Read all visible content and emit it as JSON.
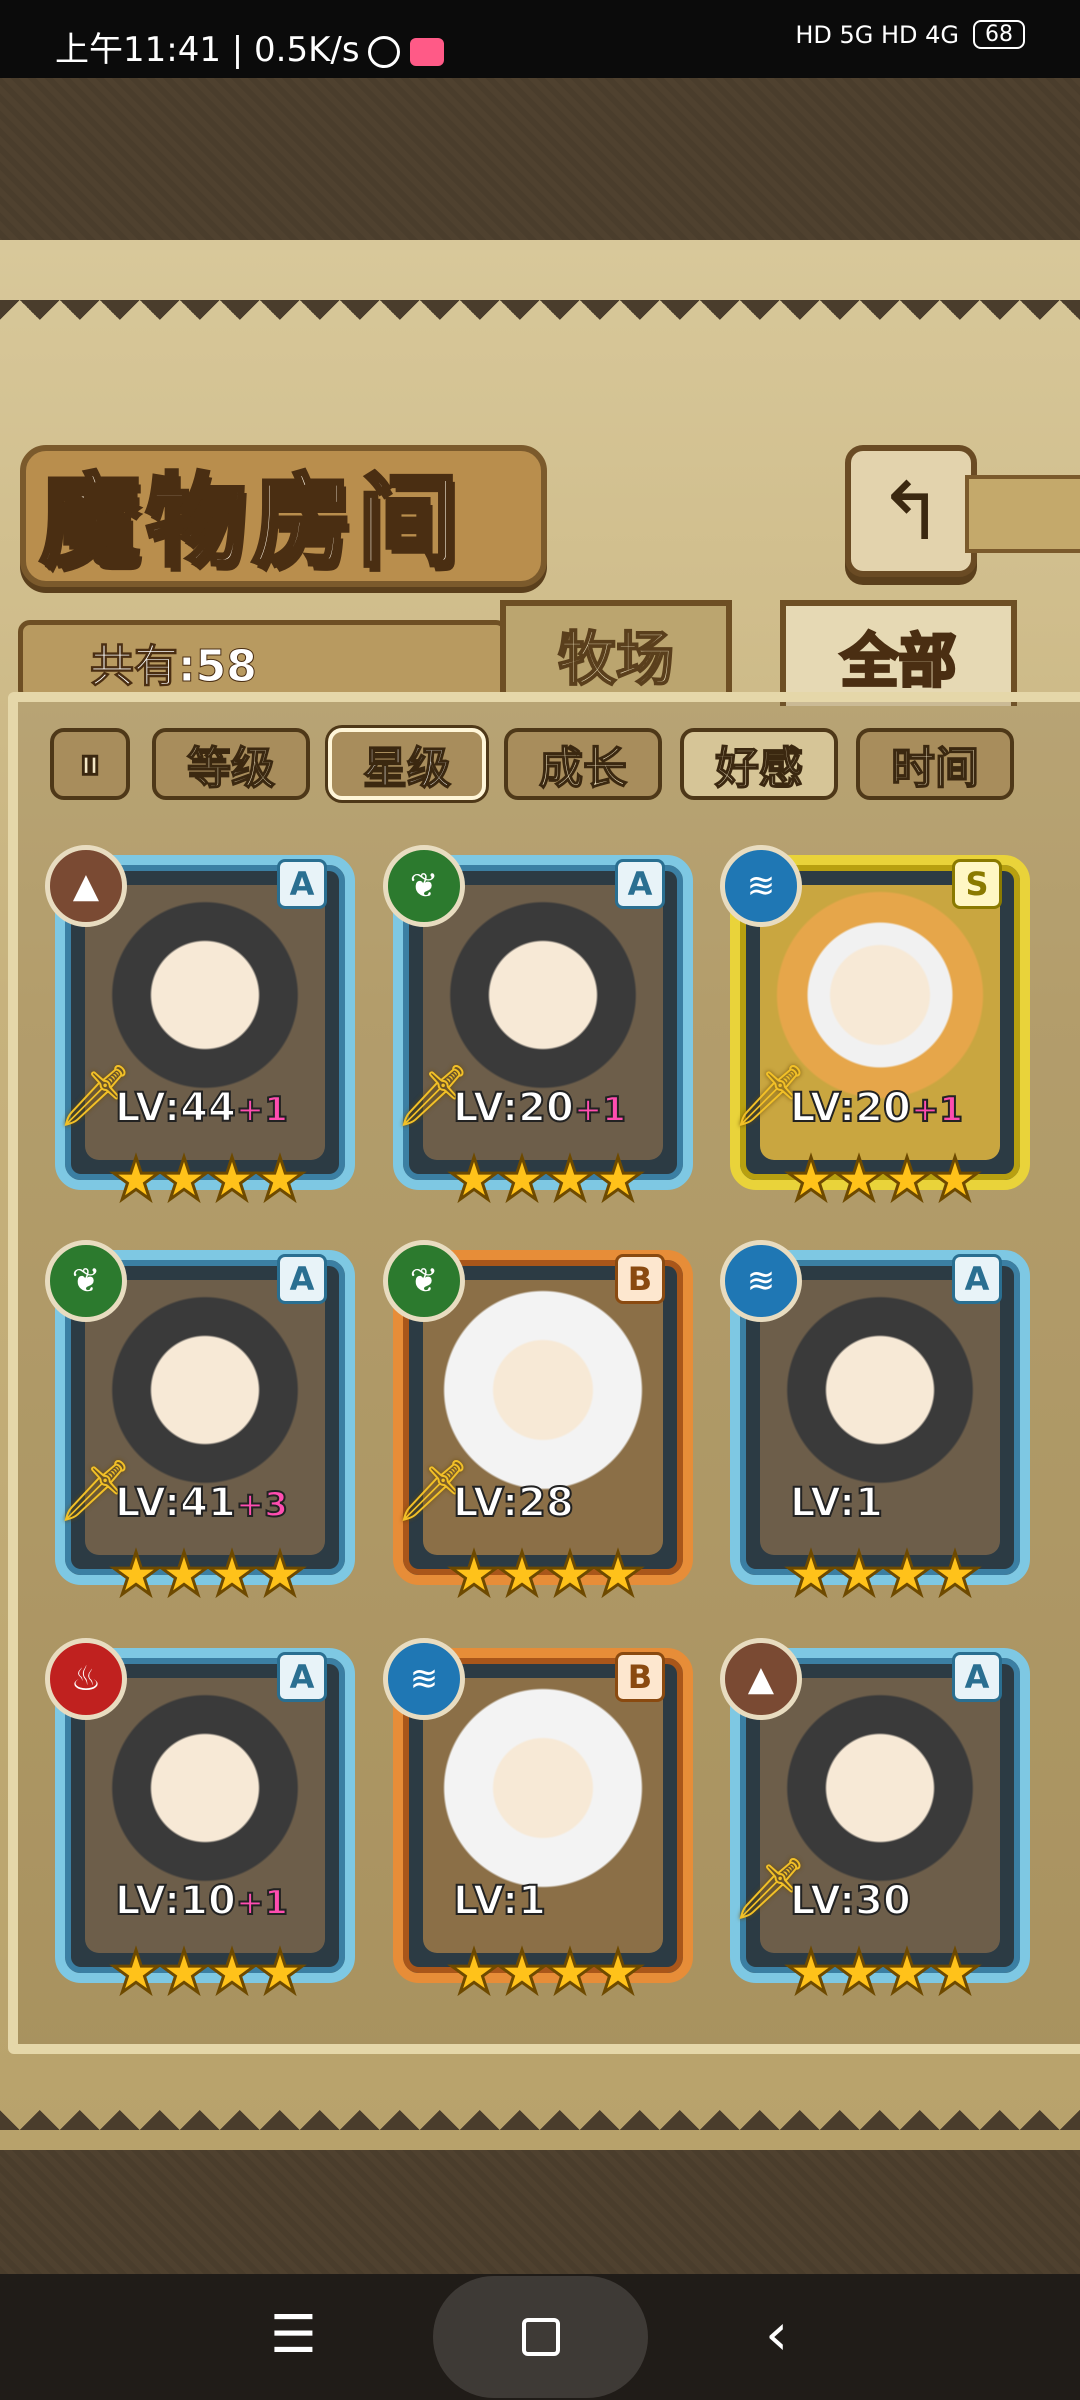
{
  "status_bar": {
    "time": "上午11:41 | 0.5K/s",
    "network": "HD 5G HD 4G",
    "battery": "68"
  },
  "header": {
    "title": "魔物房间",
    "back_icon": "return-arrow-icon",
    "back_glyph": "↰"
  },
  "summary": {
    "count_label": "共有:58"
  },
  "tabs": [
    {
      "label": "牧场",
      "active": false
    },
    {
      "label": "全部",
      "active": true
    }
  ],
  "filters": {
    "sort_icon": "sort-order-icon",
    "sort_glyph": "⏸",
    "items": [
      {
        "label": "等级",
        "active": false
      },
      {
        "label": "星级",
        "active": true
      },
      {
        "label": "成长",
        "active": false
      },
      {
        "label": "好感",
        "active": false
      },
      {
        "label": "时间",
        "active": false
      }
    ]
  },
  "monsters": [
    {
      "element": "earth",
      "element_glyph": "▲",
      "grade": "A",
      "level": "LV:44",
      "bonus": "+1",
      "stars": "★★★★",
      "weapon": true
    },
    {
      "element": "grass",
      "element_glyph": "❦",
      "grade": "A",
      "level": "LV:20",
      "bonus": "+1",
      "stars": "★★★★",
      "weapon": true
    },
    {
      "element": "water",
      "element_glyph": "≋",
      "grade": "S",
      "level": "LV:20",
      "bonus": "+1",
      "stars": "★★★★",
      "weapon": true
    },
    {
      "element": "grass",
      "element_glyph": "❦",
      "grade": "A",
      "level": "LV:41",
      "bonus": "+3",
      "stars": "★★★★",
      "weapon": true
    },
    {
      "element": "grass",
      "element_glyph": "❦",
      "grade": "B",
      "level": "LV:28",
      "bonus": "",
      "stars": "★★★★",
      "weapon": true
    },
    {
      "element": "water",
      "element_glyph": "≋",
      "grade": "A",
      "level": "LV:1",
      "bonus": "",
      "stars": "★★★★",
      "weapon": false
    },
    {
      "element": "fire",
      "element_glyph": "♨",
      "grade": "A",
      "level": "LV:10",
      "bonus": "+1",
      "stars": "★★★★",
      "weapon": false
    },
    {
      "element": "water",
      "element_glyph": "≋",
      "grade": "B",
      "level": "LV:1",
      "bonus": "",
      "stars": "★★★★",
      "weapon": false
    },
    {
      "element": "earth",
      "element_glyph": "▲",
      "grade": "A",
      "level": "LV:30",
      "bonus": "",
      "stars": "★★★★",
      "weapon": true
    }
  ],
  "nav": {
    "menu_glyph": "☰",
    "back_glyph": "‹"
  }
}
